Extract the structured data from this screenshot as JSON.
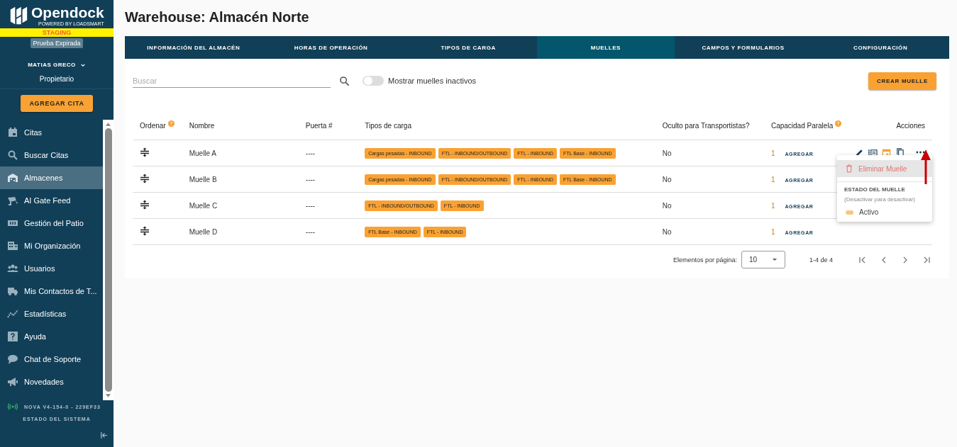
{
  "sidebar": {
    "brand": "Opendock",
    "tagline": "POWERED BY LOADSMART",
    "environment": "STAGING",
    "trial_badge": "Prueba Expirada",
    "user": "MATIAS GRECO",
    "role": "Propietario",
    "primary_button": "AGREGAR CITA",
    "items": [
      {
        "label": "Citas",
        "selected": false
      },
      {
        "label": "Buscar Citas",
        "selected": false
      },
      {
        "label": "Almacenes",
        "selected": true
      },
      {
        "label": "AI Gate Feed",
        "selected": false
      },
      {
        "label": "Gestión del Patio",
        "selected": false
      },
      {
        "label": "Mi Organización",
        "selected": false
      },
      {
        "label": "Usuarios",
        "selected": false
      },
      {
        "label": "Mis Contactos de T...",
        "selected": false
      },
      {
        "label": "Estadísticas",
        "selected": false
      },
      {
        "label": "Ayuda",
        "selected": false
      },
      {
        "label": "Chat de Soporte",
        "selected": false
      },
      {
        "label": "Novedades",
        "selected": false
      }
    ],
    "version": "NOVA V4-154-0 - 229EF33",
    "system_status": "ESTADO DEL SISTEMA"
  },
  "page": {
    "title": "Warehouse: Almacén Norte"
  },
  "tabs": [
    {
      "label": "INFORMACIÓN DEL ALMACÉN",
      "selected": false
    },
    {
      "label": "HORAS DE OPERACIÓN",
      "selected": false
    },
    {
      "label": "TIPOS DE CARGA",
      "selected": false
    },
    {
      "label": "MUELLES",
      "selected": true
    },
    {
      "label": "CAMPOS Y FORMULARIOS",
      "selected": false
    },
    {
      "label": "CONFIGURACIÓN",
      "selected": false
    }
  ],
  "toolbar": {
    "search": {
      "placeholder": "Buscar"
    },
    "inactive_toggle": {
      "label": "Mostrar muelles inactivos",
      "on": false
    },
    "create_button": "CREAR MUELLE"
  },
  "table": {
    "columns": [
      {
        "label": "Ordenar",
        "help": true
      },
      {
        "label": "Nombre",
        "help": false
      },
      {
        "label": "Puerta #",
        "help": false
      },
      {
        "label": "Tipos de carga",
        "help": false
      },
      {
        "label": "Oculto para Transportistas?",
        "help": false
      },
      {
        "label": "Capacidad Paralela",
        "help": true
      },
      {
        "label": "Acciones",
        "help": false
      }
    ],
    "rows": [
      {
        "name": "Muelle A",
        "door": "----",
        "load_types": [
          "Cargas pesadas - INBOUND",
          "FTL - INBOUND/OUTBOUND",
          "FTL - INBOUND",
          "FTL Base - INBOUND"
        ],
        "hidden": "No",
        "capacity": "1",
        "add": "AGREGAR"
      },
      {
        "name": "Muelle B",
        "door": "----",
        "load_types": [
          "Cargas pesadas - INBOUND",
          "FTL - INBOUND/OUTBOUND",
          "FTL - INBOUND",
          "FTL Base - INBOUND"
        ],
        "hidden": "No",
        "capacity": "1",
        "add": "AGREGAR"
      },
      {
        "name": "Muelle C",
        "door": "----",
        "load_types": [
          "FTL - INBOUND/OUTBOUND",
          "FTL - INBOUND"
        ],
        "hidden": "No",
        "capacity": "1",
        "add": "AGREGAR"
      },
      {
        "name": "Muelle D",
        "door": "----",
        "load_types": [
          "FTL Base - INBOUND",
          "FTL - INBOUND"
        ],
        "hidden": "No",
        "capacity": "1",
        "add": "AGREGAR"
      }
    ]
  },
  "actions_menu": {
    "delete": "Eliminar Muelle",
    "delete_selected": true,
    "section_title": "ESTADO DEL MUELLE",
    "section_hint": "(Desactivar para desactivar)",
    "active_toggle": {
      "label": "Activo",
      "on": true
    }
  },
  "pagination": {
    "per_page_label": "Elementos por página:",
    "per_page": "10",
    "range": "1-4 de 4"
  }
}
